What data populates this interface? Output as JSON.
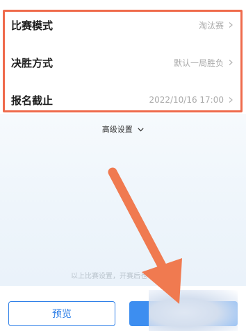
{
  "settings": {
    "rows": [
      {
        "label": "比赛模式",
        "value": "淘汰赛"
      },
      {
        "label": "决胜方式",
        "value": "默认一局胜负"
      },
      {
        "label": "报名截止",
        "value": "2022/10/16 17:00"
      }
    ],
    "advanced_label": "高级设置"
  },
  "notice_text": "以上比赛设置，开赛后也可以修改",
  "buttons": {
    "preview_label": "预览",
    "primary_label": ""
  },
  "colors": {
    "accent": "#2f80e8",
    "highlight": "#ef6a4b",
    "arrow": "#f07a50"
  },
  "icons": {
    "chevron": "chevron-right-icon",
    "dropdown": "chevron-down-icon"
  }
}
